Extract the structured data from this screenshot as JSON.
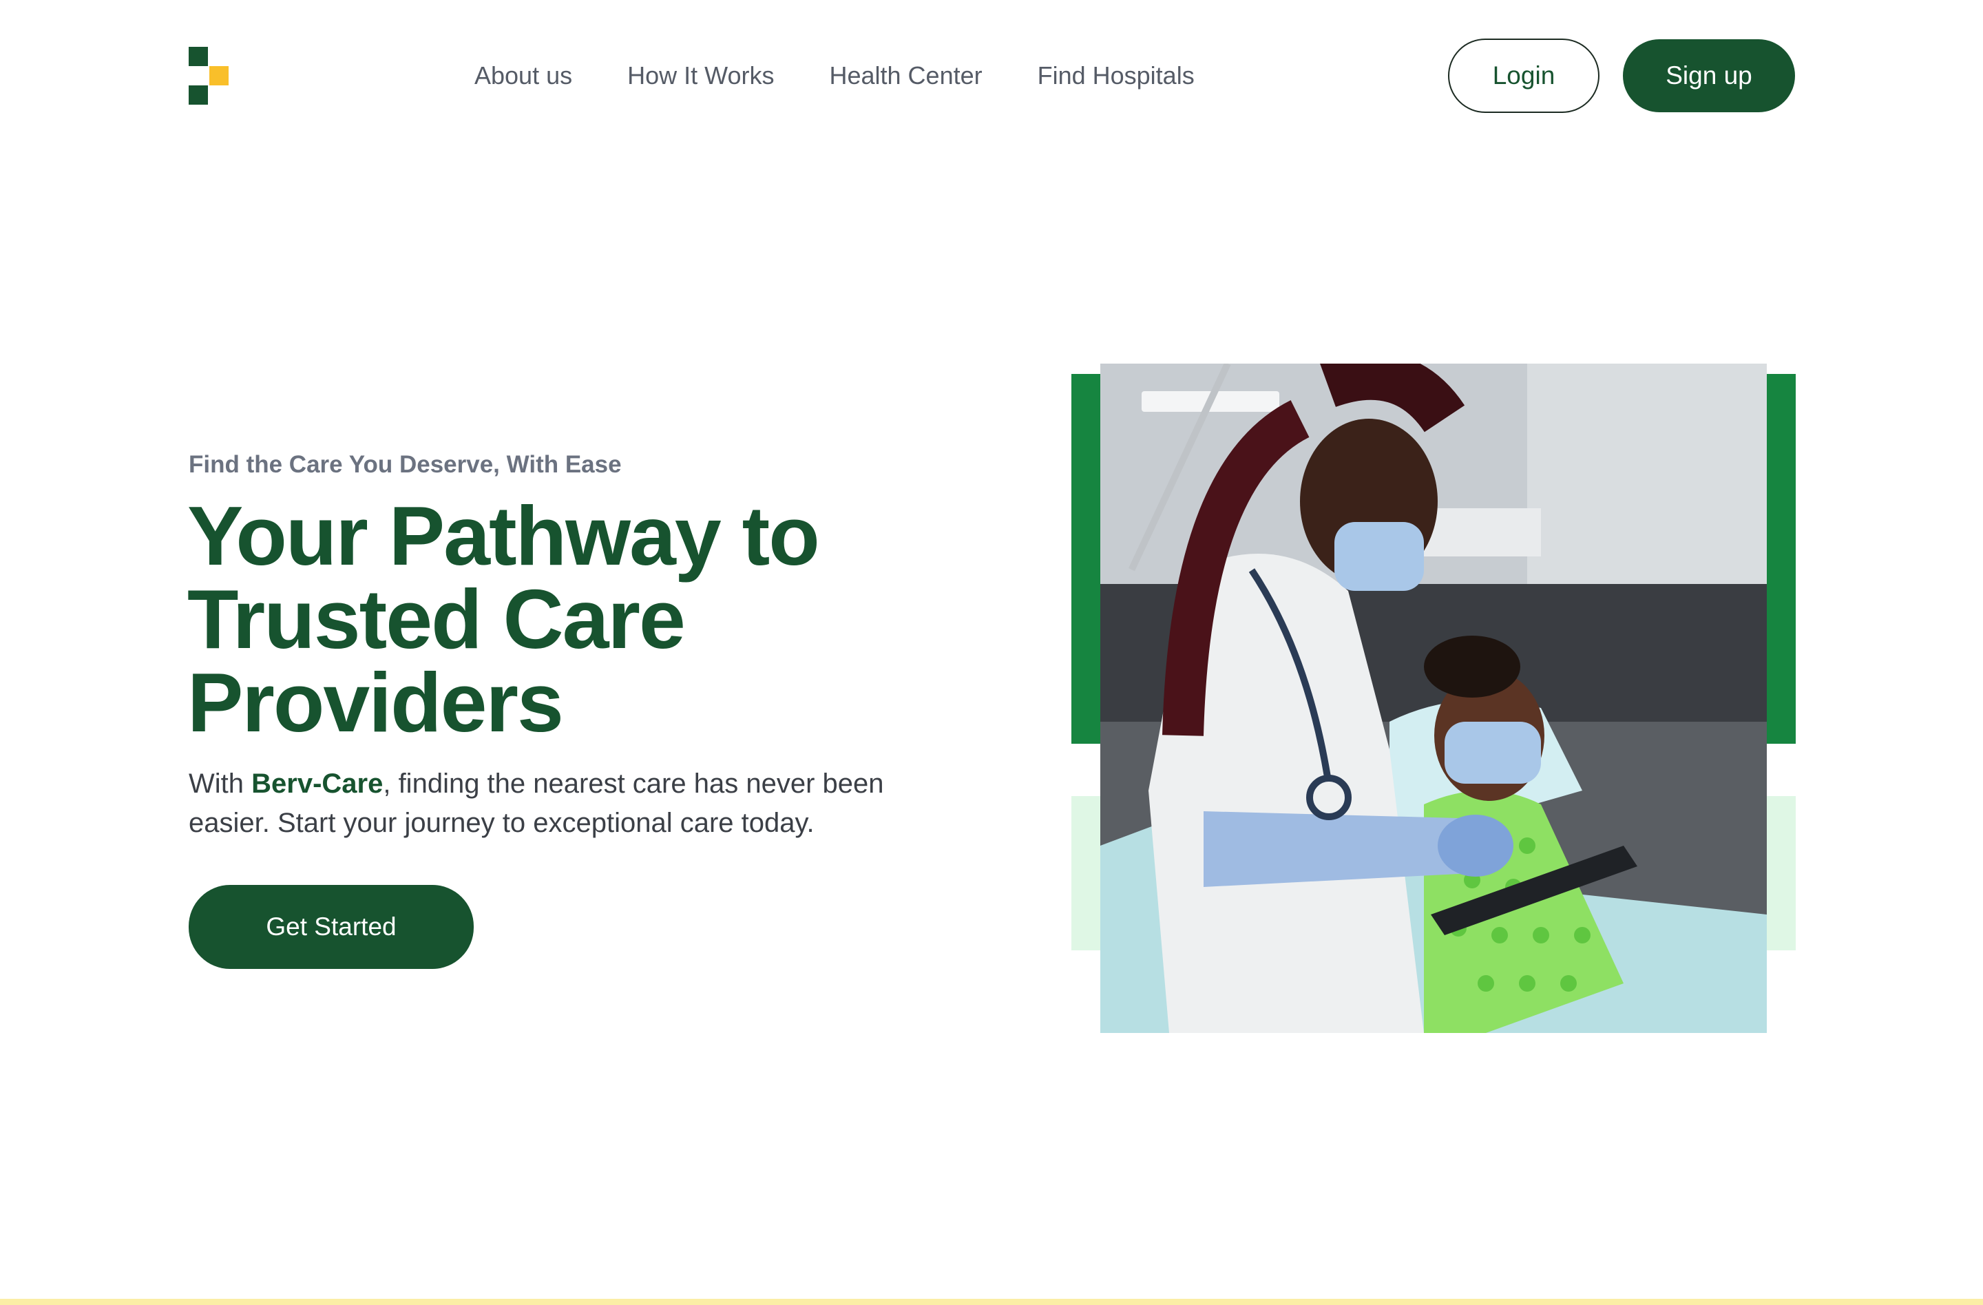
{
  "brand": {
    "logo_icon": "blocks-logo-icon",
    "colors": {
      "primary": "#17532f",
      "accent_yellow": "#f9bf2a",
      "accent_green": "#168540",
      "accent_light": "#dff7e5"
    }
  },
  "nav": {
    "items": [
      {
        "label": "About us"
      },
      {
        "label": "How It Works"
      },
      {
        "label": "Health Center"
      },
      {
        "label": "Find Hospitals"
      }
    ]
  },
  "auth": {
    "login_label": "Login",
    "signup_label": "Sign up"
  },
  "hero": {
    "eyebrow": "Find the Care You Deserve, With Ease",
    "headline_lines": [
      "Your Pathway to",
      "Trusted Care",
      "Providers"
    ],
    "description_prefix": "With ",
    "description_brand": "Berv-Care",
    "description_suffix": ", finding the nearest care has never been easier. Start your journey to exceptional care today.",
    "cta_label": "Get Started",
    "image_icon": "doctor-with-patient-photo"
  }
}
